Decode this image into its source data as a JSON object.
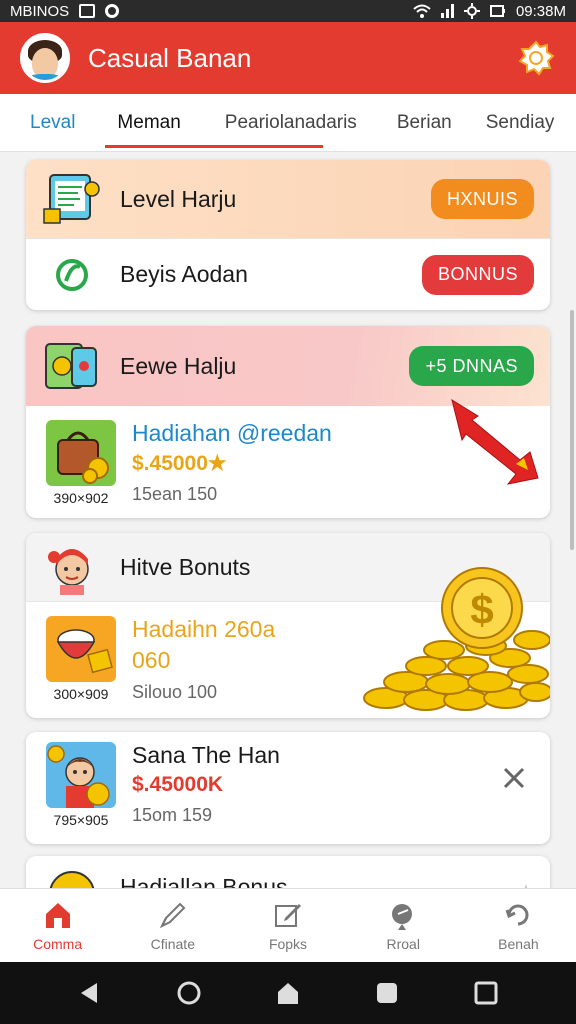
{
  "status_bar": {
    "left_text": "MBINOS",
    "right_text": "09:38M"
  },
  "app": {
    "title": "Casual Banan"
  },
  "tabs": [
    {
      "label": "Leval"
    },
    {
      "label": "Meman"
    },
    {
      "label": "Peariolanadaris"
    },
    {
      "label": "Berian"
    },
    {
      "label": "Sendiay"
    }
  ],
  "cards": {
    "level_harju": {
      "title": "Level Harju",
      "button": "HXNUIS"
    },
    "beyis_aodan": {
      "title": "Beyis Aodan",
      "button": "BONNUS"
    },
    "eewe_halju": {
      "title": "Eewe Halju",
      "button": "+5 DNNAS"
    },
    "hadiahan_reedan": {
      "title": "Hadiahan @reedan",
      "price": "$.45000★",
      "meta": "15ean 150",
      "dims": "390×902"
    },
    "hitve_bonuts": {
      "title": "Hitve Bonuts"
    },
    "hadaihn": {
      "title": "Hadaihn 260a",
      "price": "060",
      "meta": "Silouo 100",
      "dims": "300×909"
    },
    "sana": {
      "title": "Sana The Han",
      "price": "$.45000K",
      "meta": "15om 159",
      "dims": "795×905"
    },
    "partial": {
      "title": "Hadiallan Bonus"
    }
  },
  "bottom_nav": [
    {
      "label": "Comma",
      "icon": "home-icon"
    },
    {
      "label": "Cfinate",
      "icon": "pen-icon"
    },
    {
      "label": "Fopks",
      "icon": "edit-icon"
    },
    {
      "label": "Rroal",
      "icon": "pin-icon"
    },
    {
      "label": "Benah",
      "icon": "refresh-icon"
    }
  ],
  "colors": {
    "primary": "#e33b2f",
    "blue": "#1e88c8",
    "gold": "#e8a51a"
  }
}
